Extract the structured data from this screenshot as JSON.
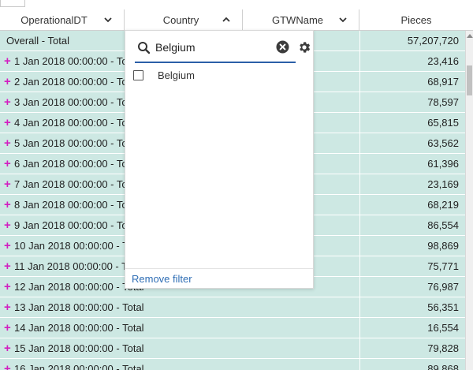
{
  "header": {
    "columns": [
      {
        "label": "OperationalDT",
        "sort": "chevron-down"
      },
      {
        "label": "Country",
        "sort": "chevron-up"
      },
      {
        "label": "GTWName",
        "sort": "chevron-down"
      },
      {
        "label": "Pieces",
        "sort": ""
      }
    ]
  },
  "grid": {
    "total_row": {
      "label": "Overall - Total",
      "value": "57,207,720"
    },
    "rows": [
      {
        "label": "1 Jan 2018 00:00:00 - Total",
        "value": "23,416"
      },
      {
        "label": "2 Jan 2018 00:00:00 - Total",
        "value": "68,917"
      },
      {
        "label": "3 Jan 2018 00:00:00 - Total",
        "value": "78,597"
      },
      {
        "label": "4 Jan 2018 00:00:00 - Total",
        "value": "65,815"
      },
      {
        "label": "5 Jan 2018 00:00:00 - Total",
        "value": "63,562"
      },
      {
        "label": "6 Jan 2018 00:00:00 - Total",
        "value": "61,396"
      },
      {
        "label": "7 Jan 2018 00:00:00 - Total",
        "value": "23,169"
      },
      {
        "label": "8 Jan 2018 00:00:00 - Total",
        "value": "68,219"
      },
      {
        "label": "9 Jan 2018 00:00:00 - Total",
        "value": "86,554"
      },
      {
        "label": "10 Jan 2018 00:00:00 - Total",
        "value": "98,869"
      },
      {
        "label": "11 Jan 2018 00:00:00 - Total",
        "value": "75,771"
      },
      {
        "label": "12 Jan 2018 00:00:00 - Total",
        "value": "76,987"
      },
      {
        "label": "13 Jan 2018 00:00:00 - Total",
        "value": "56,351"
      },
      {
        "label": "14 Jan 2018 00:00:00 - Total",
        "value": "16,554"
      },
      {
        "label": "15 Jan 2018 00:00:00 - Total",
        "value": "79,828"
      },
      {
        "label": "16 Jan 2018 00:00:00 - Total",
        "value": "89,868"
      }
    ],
    "expand_glyph": "+"
  },
  "filter_popup": {
    "search_value": "Belgium",
    "options": [
      {
        "label": "Belgium",
        "checked": false
      }
    ],
    "remove_label": "Remove filter",
    "icons": {
      "search": "search-icon",
      "clear": "clear-circle-icon",
      "settings": "gear-icon"
    }
  },
  "colors": {
    "row_bg": "#cde8e3",
    "expand_plus": "#d21ec0",
    "accent": "#2b5fa8",
    "link": "#2f6eb5"
  }
}
